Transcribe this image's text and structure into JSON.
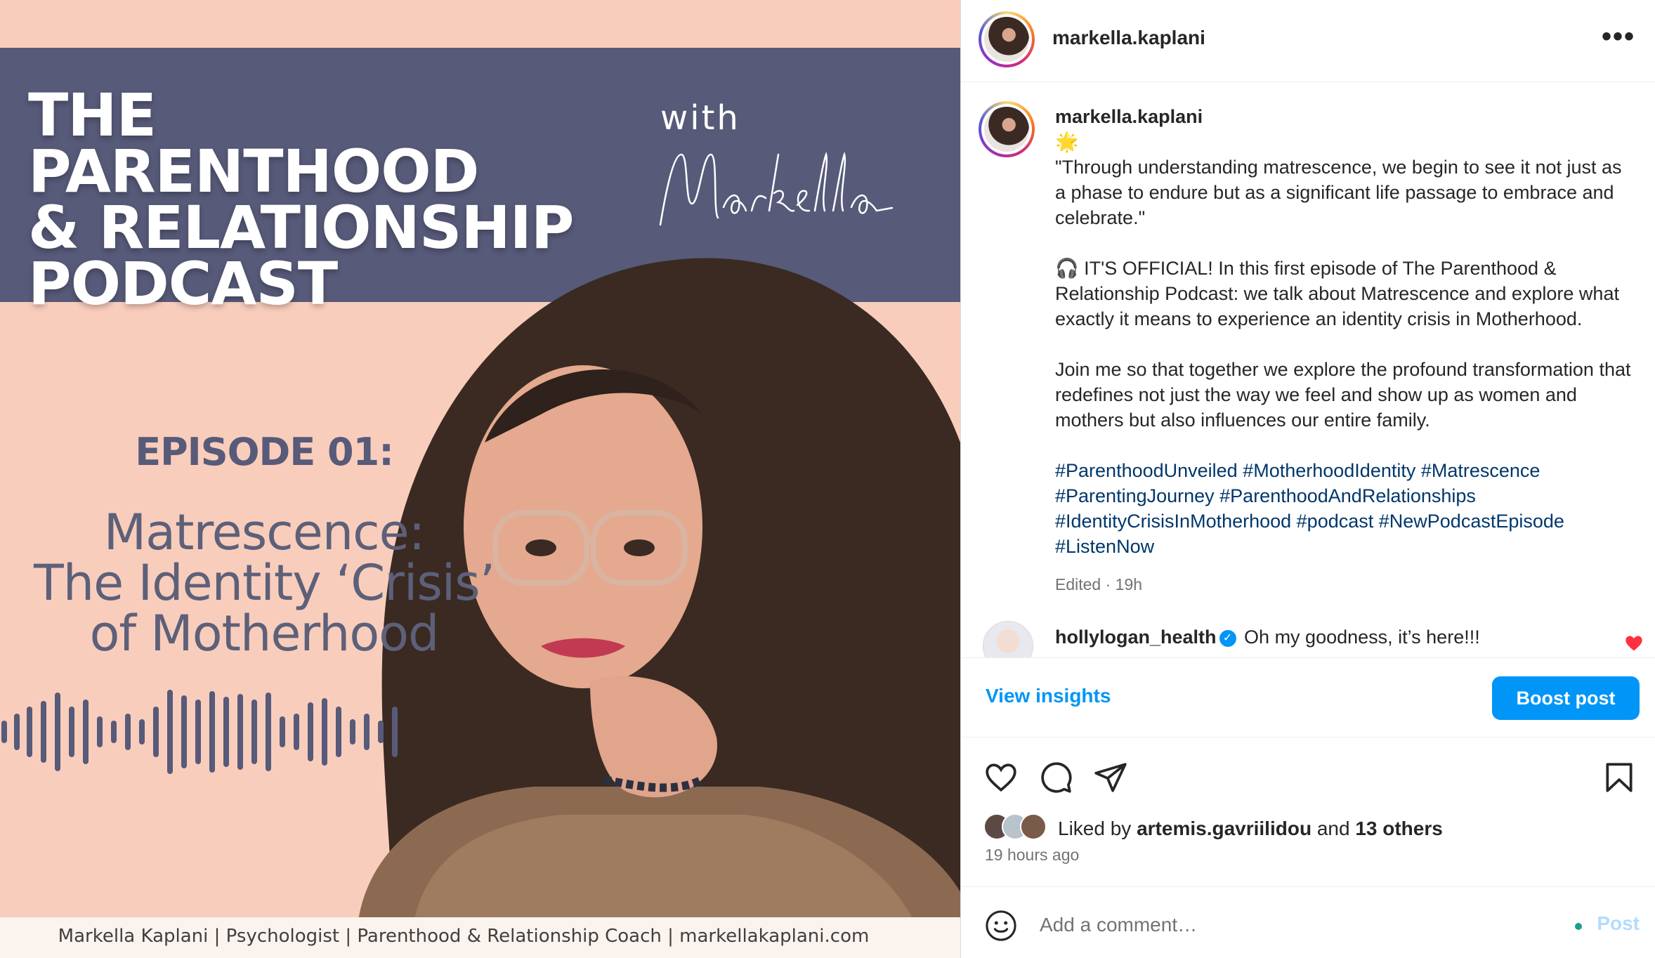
{
  "artwork": {
    "title": "THE PARENTHOOD\n& RELATIONSHIP\nPODCAST",
    "with_label": "with",
    "signature": "Markella",
    "episode_label": "EPISODE 01:",
    "episode_title": "Matrescence:\nThe Identity ‘Crisis’\nof Motherhood",
    "footer": "Markella Kaplani | Psychologist | Parenthood & Relationship Coach | markellakaplani.com",
    "colors": {
      "banner": "#575a79",
      "background": "#f9cdbc",
      "text_slate": "#575a79"
    }
  },
  "header": {
    "username": "markella.kaplani",
    "more_icon": "more-horizontal-icon"
  },
  "caption": {
    "username": "markella.kaplani",
    "emoji": "🌟",
    "quote": "\"Through understanding matrescence, we begin to see it not just as a phase to endure but as a significant life passage to embrace and celebrate.\"",
    "paragraph1": "🎧 IT'S OFFICIAL! In this first episode of The Parenthood & Relationship Podcast: we talk about Matrescence and explore what exactly it means to experience an identity crisis in Motherhood.",
    "paragraph2": "Join me so that together we explore the profound transformation that redefines not just the way we feel and show up as women and mothers but also influences our entire family.",
    "hashtags": "#ParenthoodUnveiled #MotherhoodIdentity #Matrescence #ParentingJourney #ParenthoodAndRelationships #IdentityCrisisInMotherhood #podcast #NewPodcastEpisode #ListenNow",
    "meta": "Edited · 19h"
  },
  "comment": {
    "username": "hollylogan_health",
    "text": "Oh my goodness, it’s here!!!",
    "verified_icon": "verified-badge-icon",
    "liked": true
  },
  "insights": {
    "view_label": "View insights",
    "boost_label": "Boost post"
  },
  "actions": {
    "icons": [
      "heart-icon",
      "comment-icon",
      "share-icon",
      "bookmark-icon"
    ]
  },
  "likes": {
    "prefix": "Liked by",
    "user": "artemis.gavriilidou",
    "and": "and",
    "others": "13 others"
  },
  "timestamp": "19 hours ago",
  "add_comment": {
    "placeholder": "Add a comment…",
    "post_label": "Post"
  },
  "colors": {
    "accent": "#0095f6",
    "hashtag": "#00376b",
    "muted": "#737373",
    "like_red": "#ff3040"
  }
}
